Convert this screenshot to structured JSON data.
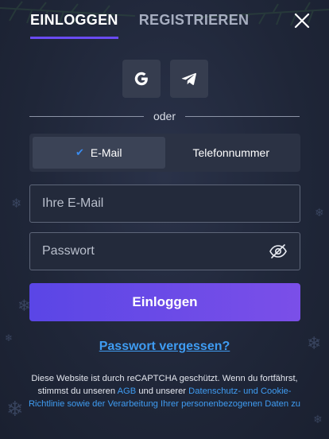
{
  "tabs": {
    "login": "EINLOGGEN",
    "register": "REGISTRIEREN"
  },
  "icons": {
    "close": "close-icon",
    "google": "google-icon",
    "telegram": "telegram-icon",
    "check": "check-icon",
    "eye": "eye-hidden-icon"
  },
  "divider_text": "oder",
  "switch": {
    "email_label": "E-Mail",
    "phone_label": "Telefonnummer",
    "selected": "E-Mail"
  },
  "form": {
    "email_placeholder": "Ihre E-Mail",
    "email_value": "",
    "password_placeholder": "Passwort",
    "password_value": "",
    "submit_label": "Einloggen",
    "forgot_label": "Passwort vergessen?"
  },
  "legal": {
    "text_1": "Diese Website ist durch reCAPTCHA geschützt. Wenn du fortfährst, stimmst du unseren ",
    "link_agb": "AGB",
    "text_2": " und unserer ",
    "link_privacy": "Datenschutz- und Cookie-Richtlinie sowie der Verarbeitung Ihrer personenbezogenen Daten zu"
  },
  "colors": {
    "accent": "#6a4bf2",
    "link": "#3f9cf2",
    "background": "#1f2638",
    "button_gradient_start": "#5a46e6",
    "button_gradient_end": "#7b4fe8"
  }
}
